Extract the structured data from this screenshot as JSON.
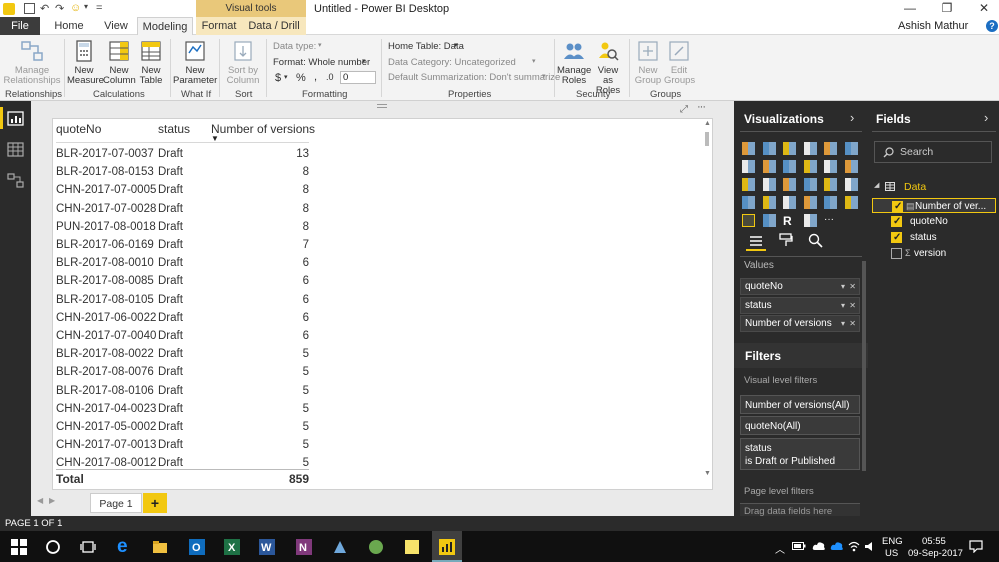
{
  "title_bar": {
    "title": "Untitled - Power BI Desktop",
    "visual_tools": "Visual tools",
    "quick_access_marker": "="
  },
  "tabs": {
    "file": "File",
    "home": "Home",
    "view": "View",
    "modeling": "Modeling",
    "format": "Format",
    "data_drill": "Data / Drill",
    "user": "Ashish Mathur",
    "help": "?"
  },
  "ribbon": {
    "manage_relationships": "Manage Relationships",
    "new_measure": "New Measure",
    "new_column": "New Column",
    "new_table": "New Table",
    "new_parameter": "New Parameter",
    "sort_by_column": "Sort by Column",
    "data_type": "Data type:",
    "format": "Format: Whole number",
    "dollar": "$",
    "percent": "%",
    "comma": ",",
    "decimal": ".0",
    "decimal_value": "0",
    "home_table": "Home Table: Data",
    "data_category": "Data Category: Uncategorized",
    "default_summarization": "Default Summarization: Don't summarize",
    "manage_roles": "Manage Roles",
    "view_as_roles": "View as Roles",
    "new_group": "New Group",
    "edit_groups": "Edit Groups",
    "groups": {
      "relationships": "Relationships",
      "calculations": "Calculations",
      "what_if": "What If",
      "sort": "Sort",
      "formatting": "Formatting",
      "properties": "Properties",
      "security": "Security",
      "groups": "Groups"
    }
  },
  "table": {
    "headers": {
      "quoteNo": "quoteNo",
      "status": "status",
      "count": "Number of versions"
    },
    "rows": [
      {
        "quoteNo": "BLR-2017-07-0037",
        "status": "Draft",
        "count": "13"
      },
      {
        "quoteNo": "BLR-2017-08-0153",
        "status": "Draft",
        "count": "8"
      },
      {
        "quoteNo": "CHN-2017-07-0005",
        "status": "Draft",
        "count": "8"
      },
      {
        "quoteNo": "CHN-2017-07-0028",
        "status": "Draft",
        "count": "8"
      },
      {
        "quoteNo": "PUN-2017-08-0018",
        "status": "Draft",
        "count": "8"
      },
      {
        "quoteNo": "BLR-2017-06-0169",
        "status": "Draft",
        "count": "7"
      },
      {
        "quoteNo": "BLR-2017-08-0010",
        "status": "Draft",
        "count": "6"
      },
      {
        "quoteNo": "BLR-2017-08-0085",
        "status": "Draft",
        "count": "6"
      },
      {
        "quoteNo": "BLR-2017-08-0105",
        "status": "Draft",
        "count": "6"
      },
      {
        "quoteNo": "CHN-2017-06-0022",
        "status": "Draft",
        "count": "6"
      },
      {
        "quoteNo": "CHN-2017-07-0040",
        "status": "Draft",
        "count": "6"
      },
      {
        "quoteNo": "BLR-2017-08-0022",
        "status": "Draft",
        "count": "5"
      },
      {
        "quoteNo": "BLR-2017-08-0076",
        "status": "Draft",
        "count": "5"
      },
      {
        "quoteNo": "BLR-2017-08-0106",
        "status": "Draft",
        "count": "5"
      },
      {
        "quoteNo": "CHN-2017-04-0023",
        "status": "Draft",
        "count": "5"
      },
      {
        "quoteNo": "CHN-2017-05-0002",
        "status": "Draft",
        "count": "5"
      },
      {
        "quoteNo": "CHN-2017-07-0013",
        "status": "Draft",
        "count": "5"
      },
      {
        "quoteNo": "CHN-2017-08-0012",
        "status": "Draft",
        "count": "5"
      }
    ],
    "total_label": "Total",
    "total_value": "859"
  },
  "pages": {
    "page1": "Page 1",
    "add": "+"
  },
  "status_bar": "PAGE 1 OF 1",
  "visualizations": {
    "title": "Visualizations",
    "values_label": "Values",
    "wells": [
      "quoteNo",
      "status",
      "Number of versions"
    ],
    "filters_title": "Filters",
    "visual_level_filters": "Visual level filters",
    "filter_cards": [
      "Number of versions(All)",
      "quoteNo(All)"
    ],
    "status_filter_name": "status",
    "status_filter_value": "is Draft or Published",
    "page_level_filters": "Page level filters",
    "drag_hint": "Drag data fields here"
  },
  "fields": {
    "title": "Fields",
    "search_placeholder": "Search",
    "table_name": "Data",
    "items": [
      {
        "name": "Number of ver...",
        "checked": true
      },
      {
        "name": "quoteNo",
        "checked": true
      },
      {
        "name": "status",
        "checked": true
      },
      {
        "name": "version",
        "checked": false
      }
    ]
  },
  "taskbar": {
    "lang1": "ENG",
    "lang2": "US",
    "time": "05:55",
    "date": "09-Sep-2017"
  },
  "colors": {
    "accent": "#f2c811",
    "dark_pane": "#2b2b2b",
    "visual_tools": "#e9c87a"
  }
}
